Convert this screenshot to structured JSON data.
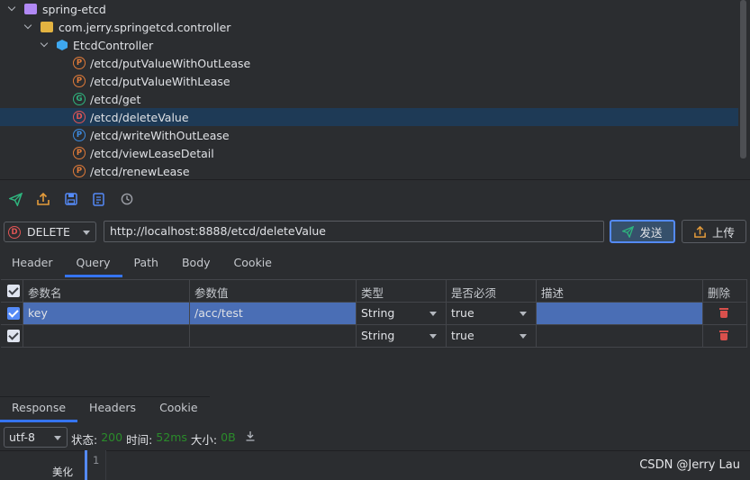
{
  "tree": {
    "project": "spring-etcd",
    "package": "com.jerry.springetcd.controller",
    "controller": "EtcdController",
    "endpoints": [
      {
        "badge": "P",
        "path": "/etcd/putValueWithOutLease"
      },
      {
        "badge": "P",
        "path": "/etcd/putValueWithLease"
      },
      {
        "badge": "G",
        "path": "/etcd/get"
      },
      {
        "badge": "D",
        "path": "/etcd/deleteValue"
      },
      {
        "badge": "P",
        "path": "/etcd/writeWithOutLease"
      },
      {
        "badge": "P",
        "path": "/etcd/viewLeaseDetail"
      },
      {
        "badge": "P",
        "path": "/etcd/renewLease"
      }
    ]
  },
  "request": {
    "method_badge": "D",
    "method": "DELETE",
    "url": "http://localhost:8888/etcd/deleteValue",
    "send_label": "发送",
    "upload_label": "上传"
  },
  "tabs": [
    "Header",
    "Query",
    "Path",
    "Body",
    "Cookie"
  ],
  "params": {
    "headers": [
      "参数名",
      "参数值",
      "类型",
      "是否必须",
      "描述",
      "删除"
    ],
    "rows": [
      {
        "name": "key",
        "value": "/acc/test",
        "type": "String",
        "required": "true",
        "desc": ""
      },
      {
        "name": "",
        "value": "",
        "type": "String",
        "required": "true",
        "desc": ""
      }
    ]
  },
  "response": {
    "tabs": [
      "Response",
      "Headers",
      "Cookie"
    ],
    "encoding": "utf-8",
    "status_label": "状态:",
    "status_value": "200",
    "time_label": "时间:",
    "time_value": "52ms",
    "size_label": "大小:",
    "size_value": "0B",
    "line_number": "1",
    "beautify_label": "美化"
  },
  "watermark": "CSDN @Jerry Lau",
  "colors": {
    "accent": "#548af7",
    "post": "#e07b39",
    "get": "#2fb57e",
    "delete": "#e05555",
    "status_green": "#2a8c2a"
  }
}
